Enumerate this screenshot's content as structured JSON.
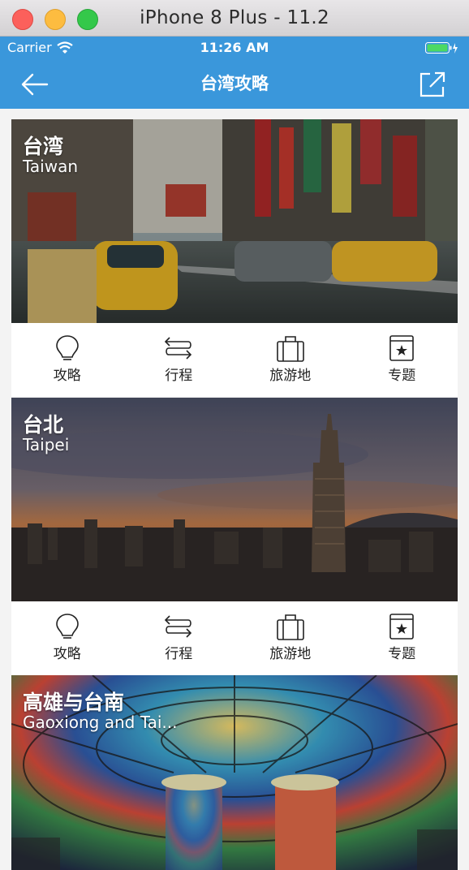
{
  "window": {
    "title": "iPhone 8 Plus - 11.2"
  },
  "status_bar": {
    "carrier": "Carrier",
    "time": "11:26 AM"
  },
  "nav": {
    "title": "台湾攻略"
  },
  "cards": [
    {
      "name_zh": "台湾",
      "name_en": "Taiwan",
      "actions": [
        {
          "label": "攻略",
          "icon": "lightbulb-icon"
        },
        {
          "label": "行程",
          "icon": "route-icon"
        },
        {
          "label": "旅游地",
          "icon": "luggage-icon"
        },
        {
          "label": "专题",
          "icon": "book-star-icon"
        }
      ]
    },
    {
      "name_zh": "台北",
      "name_en": "Taipei",
      "actions": [
        {
          "label": "攻略",
          "icon": "lightbulb-icon"
        },
        {
          "label": "行程",
          "icon": "route-icon"
        },
        {
          "label": "旅游地",
          "icon": "luggage-icon"
        },
        {
          "label": "专题",
          "icon": "book-star-icon"
        }
      ]
    },
    {
      "name_zh": "高雄与台南",
      "name_en": "Gaoxiong and Tai..."
    }
  ],
  "colors": {
    "accent": "#3a97db"
  }
}
